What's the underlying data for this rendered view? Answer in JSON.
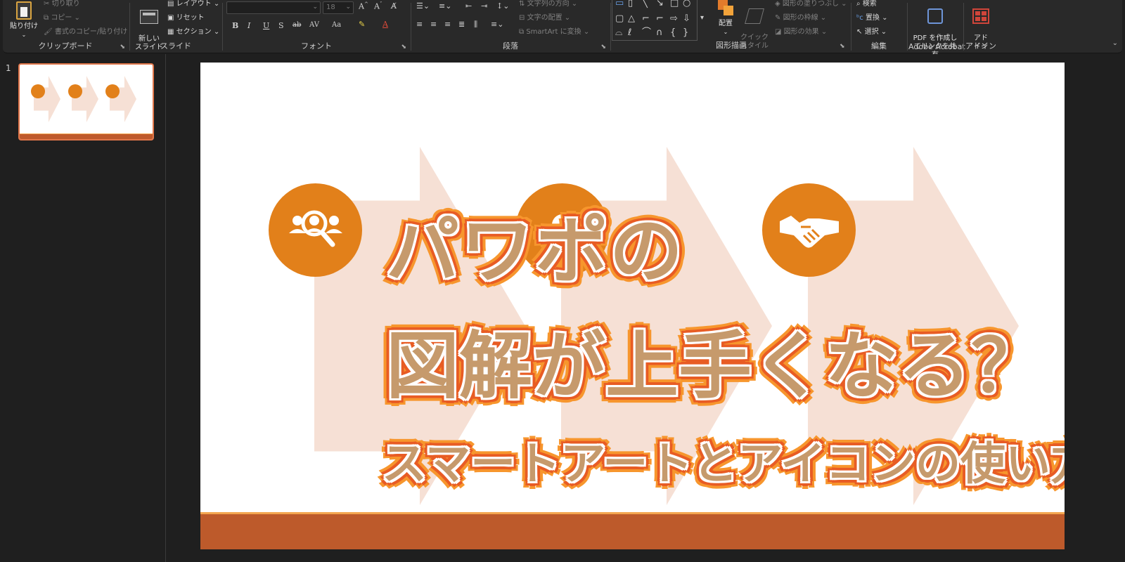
{
  "ribbon": {
    "clipboard": {
      "paste": "貼り付け",
      "cut": "切り取り",
      "copy": "コピー",
      "format_painter": "書式のコピー/貼り付け",
      "label": "クリップボード"
    },
    "slides": {
      "new_slide": "新しい\nスライド",
      "layout": "レイアウト",
      "reset": "リセット",
      "section": "セクション",
      "label": "スライド"
    },
    "font": {
      "font_name": "",
      "font_size": "18",
      "label": "フォント",
      "buttons": [
        "B",
        "I",
        "U",
        "S",
        "ab",
        "AV",
        "Aa"
      ]
    },
    "paragraph": {
      "text_direction": "文字列の方向",
      "align_text": "文字の配置",
      "smartart": "SmartArt に変換",
      "label": "段落"
    },
    "drawing": {
      "arrange": "配置",
      "quick_styles": "クイック\nスタイル",
      "shape_fill": "図形の塗りつぶし",
      "shape_outline": "図形の枠線",
      "shape_effects": "図形の効果",
      "label": "図形描画"
    },
    "editing": {
      "find": "検索",
      "replace": "置換",
      "select": "選択",
      "label": "編集"
    },
    "acrobat": {
      "create_pdf": "PDF を作成し\nてリンクを共有",
      "label": "Adobe Acrobat"
    },
    "addins": {
      "button": "アド\nイン",
      "label": "アドイン"
    }
  },
  "thumbnails": [
    {
      "number": "1"
    }
  ],
  "slide": {
    "title_line1": "パワポの",
    "title_line2": "図解が上手くなる？",
    "subtitle": "スマートアートとアイコンの使い方"
  },
  "colors": {
    "accent_orange": "#e2801a",
    "arrow_fill": "#f6e0d5",
    "band": "#bd5a2b",
    "title_fill": "#c69a6c"
  },
  "icons": [
    "people-search-icon",
    "lightbulb-icon",
    "handshake-icon"
  ]
}
